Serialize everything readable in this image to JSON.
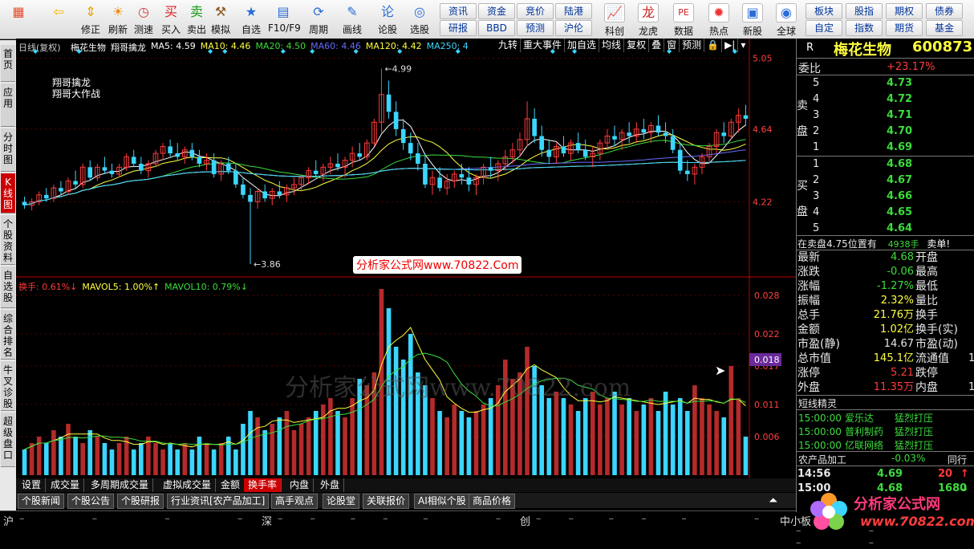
{
  "toolbar": {
    "buttons": [
      {
        "label": "",
        "icon": "grid-icon"
      },
      {
        "label": "",
        "icon": "back-icon"
      },
      {
        "label": "修正",
        "icon": "adjust-icon"
      },
      {
        "label": "刷新",
        "icon": "refresh-icon"
      },
      {
        "label": "测速",
        "icon": "clock-icon"
      },
      {
        "label": "买入",
        "icon": "buy-icon",
        "glyph": "买"
      },
      {
        "label": "卖出",
        "icon": "sell-icon",
        "glyph": "卖"
      },
      {
        "label": "模拟",
        "icon": "gavel-icon"
      },
      {
        "label": "自选",
        "icon": "star-icon"
      },
      {
        "label": "F10/F9",
        "icon": "doc-icon"
      },
      {
        "label": "周期",
        "icon": "cycle-icon"
      },
      {
        "label": "画线",
        "icon": "pencil-icon"
      },
      {
        "label": "论股",
        "icon": "chat-icon"
      },
      {
        "label": "选股",
        "icon": "select-icon"
      }
    ],
    "small_buttons": [
      "资讯",
      "资金",
      "竞价",
      "陆港",
      "研报",
      "BBD",
      "预测",
      "沪伦"
    ],
    "buttons2": [
      {
        "label": "科创",
        "icon": "chart-icon"
      },
      {
        "label": "龙虎",
        "icon": "dragon-icon"
      },
      {
        "label": "数据",
        "icon": "pe-icon",
        "glyph": "PE"
      },
      {
        "label": "热点",
        "icon": "fire-icon"
      },
      {
        "label": "新股",
        "icon": "newstock-icon"
      },
      {
        "label": "全球",
        "icon": "globe-icon"
      }
    ],
    "small_buttons2": [
      "板块",
      "股指",
      "期权",
      "债券",
      "自定",
      "指数",
      "期货",
      "基金"
    ]
  },
  "sidetabs": [
    {
      "label": "首页",
      "active": false
    },
    {
      "label": "应用",
      "active": false
    },
    {
      "label": "分时图",
      "active": false
    },
    {
      "label": "K线图",
      "active": true
    },
    {
      "label": "个股资料",
      "active": false
    },
    {
      "label": "自选股",
      "active": false
    },
    {
      "label": "综合排名",
      "active": false
    },
    {
      "label": "牛叉诊股",
      "active": false
    },
    {
      "label": "超级盘口",
      "active": false
    }
  ],
  "chart": {
    "period": "日线(复权)",
    "stock_name": "梅花生物",
    "formula": "翔哥擒龙",
    "ma": [
      {
        "label": "MA5: 4.59",
        "color": "#ffffff"
      },
      {
        "label": "MA10: 4.46",
        "color": "#ffff40"
      },
      {
        "label": "MA20: 4.50",
        "color": "#3cdc3c"
      },
      {
        "label": "MA60: 4.46",
        "color": "#6a6aff"
      },
      {
        "label": "MA120: 4.42",
        "color": "#ffff40"
      },
      {
        "label": "MA250: 4",
        "color": "#3bd6ff"
      }
    ],
    "tools": [
      "九转",
      "重大事件",
      "加自选",
      "均线",
      "复权",
      "叠",
      "窗",
      "预测"
    ],
    "legend_lines": [
      "翔哥擒龙",
      "翔哥大作战"
    ],
    "watermark_label": "分析家公式网www.70822.Com",
    "watermark_big": "分析家公式网www.70822.com",
    "vol_header": [
      {
        "label": "换手: 0.61%",
        "color": "#ff3b3b",
        "arrow": "↓"
      },
      {
        "label": "MAVOL5: 1.00%",
        "color": "#ffff40",
        "arrow": "↑"
      },
      {
        "label": "MAVOL10: 0.79%",
        "color": "#3cdc3c",
        "arrow": "↓"
      }
    ]
  },
  "chart_data": [
    {
      "type": "candlestick",
      "title": "梅花生物 日线(复权)",
      "y_ticks": [
        5.05,
        4.64,
        4.22
      ],
      "ylim": [
        3.8,
        5.08
      ],
      "annotations": [
        {
          "text": "4.99",
          "value": 4.99
        },
        {
          "text": "3.86",
          "value": 3.86
        }
      ],
      "ohlc": [
        [
          4.22,
          4.25,
          4.18,
          4.2
        ],
        [
          4.2,
          4.24,
          4.17,
          4.22
        ],
        [
          4.22,
          4.28,
          4.2,
          4.26
        ],
        [
          4.26,
          4.3,
          4.22,
          4.24
        ],
        [
          4.24,
          4.32,
          4.22,
          4.3
        ],
        [
          4.3,
          4.34,
          4.26,
          4.28
        ],
        [
          4.28,
          4.36,
          4.26,
          4.34
        ],
        [
          4.34,
          4.4,
          4.3,
          4.32
        ],
        [
          4.32,
          4.44,
          4.3,
          4.42
        ],
        [
          4.42,
          4.46,
          4.34,
          4.36
        ],
        [
          4.36,
          4.44,
          4.34,
          4.42
        ],
        [
          4.42,
          4.48,
          4.38,
          4.4
        ],
        [
          4.4,
          4.44,
          4.36,
          4.38
        ],
        [
          4.38,
          4.44,
          4.36,
          4.42
        ],
        [
          4.42,
          4.5,
          4.4,
          4.48
        ],
        [
          4.48,
          4.52,
          4.42,
          4.44
        ],
        [
          4.44,
          4.48,
          4.38,
          4.4
        ],
        [
          4.4,
          4.46,
          4.36,
          4.44
        ],
        [
          4.44,
          4.52,
          4.42,
          4.5
        ],
        [
          4.5,
          4.56,
          4.46,
          4.54
        ],
        [
          4.54,
          4.58,
          4.48,
          4.5
        ],
        [
          4.5,
          4.56,
          4.46,
          4.48
        ],
        [
          4.48,
          4.54,
          4.44,
          4.52
        ],
        [
          4.52,
          4.56,
          4.46,
          4.48
        ],
        [
          4.48,
          4.52,
          4.42,
          4.44
        ],
        [
          4.44,
          4.5,
          4.4,
          4.46
        ],
        [
          4.46,
          4.5,
          4.36,
          4.38
        ],
        [
          4.38,
          4.46,
          4.34,
          4.44
        ],
        [
          4.44,
          4.48,
          4.38,
          4.4
        ],
        [
          4.4,
          4.44,
          4.3,
          4.32
        ],
        [
          4.32,
          4.36,
          4.24,
          4.26
        ],
        [
          4.26,
          4.3,
          3.86,
          4.22
        ],
        [
          4.22,
          4.3,
          4.18,
          4.28
        ],
        [
          4.28,
          4.32,
          4.22,
          4.24
        ],
        [
          4.24,
          4.3,
          4.2,
          4.28
        ],
        [
          4.28,
          4.34,
          4.24,
          4.26
        ],
        [
          4.26,
          4.32,
          4.22,
          4.3
        ],
        [
          4.3,
          4.36,
          4.26,
          4.32
        ],
        [
          4.32,
          4.38,
          4.28,
          4.36
        ],
        [
          4.36,
          4.42,
          4.32,
          4.4
        ],
        [
          4.4,
          4.46,
          4.36,
          4.38
        ],
        [
          4.38,
          4.44,
          4.34,
          4.42
        ],
        [
          4.42,
          4.48,
          4.38,
          4.44
        ],
        [
          4.44,
          4.5,
          4.4,
          4.42
        ],
        [
          4.42,
          4.48,
          4.36,
          4.46
        ],
        [
          4.46,
          4.54,
          4.42,
          4.5
        ],
        [
          4.5,
          4.56,
          4.46,
          4.48
        ],
        [
          4.48,
          4.58,
          4.46,
          4.56
        ],
        [
          4.56,
          4.7,
          4.54,
          4.68
        ],
        [
          4.68,
          4.99,
          4.62,
          4.84
        ],
        [
          4.84,
          4.92,
          4.7,
          4.74
        ],
        [
          4.74,
          4.8,
          4.6,
          4.64
        ],
        [
          4.64,
          4.7,
          4.52,
          4.56
        ],
        [
          4.56,
          4.62,
          4.46,
          4.5
        ],
        [
          4.5,
          4.56,
          4.4,
          4.44
        ],
        [
          4.44,
          4.5,
          4.3,
          4.32
        ],
        [
          4.32,
          4.4,
          4.26,
          4.36
        ],
        [
          4.36,
          4.42,
          4.28,
          4.3
        ],
        [
          4.3,
          4.38,
          4.26,
          4.34
        ],
        [
          4.34,
          4.4,
          4.3,
          4.38
        ],
        [
          4.38,
          4.44,
          4.32,
          4.36
        ],
        [
          4.36,
          4.42,
          4.28,
          4.32
        ],
        [
          4.32,
          4.38,
          4.26,
          4.36
        ],
        [
          4.36,
          4.44,
          4.32,
          4.42
        ],
        [
          4.42,
          4.48,
          4.36,
          4.4
        ],
        [
          4.4,
          4.46,
          4.34,
          4.44
        ],
        [
          4.44,
          4.52,
          4.4,
          4.48
        ],
        [
          4.48,
          4.56,
          4.44,
          4.52
        ],
        [
          4.52,
          4.62,
          4.48,
          4.58
        ],
        [
          4.58,
          4.8,
          4.54,
          4.7
        ],
        [
          4.7,
          4.76,
          4.56,
          4.6
        ],
        [
          4.6,
          4.66,
          4.48,
          4.52
        ],
        [
          4.52,
          4.58,
          4.44,
          4.48
        ],
        [
          4.48,
          4.56,
          4.44,
          4.54
        ],
        [
          4.54,
          4.6,
          4.48,
          4.5
        ],
        [
          4.5,
          4.58,
          4.46,
          4.56
        ],
        [
          4.56,
          4.62,
          4.5,
          4.52
        ],
        [
          4.52,
          4.58,
          4.46,
          4.48
        ],
        [
          4.48,
          4.54,
          4.42,
          4.5
        ],
        [
          4.5,
          4.58,
          4.46,
          4.56
        ],
        [
          4.56,
          4.64,
          4.52,
          4.6
        ],
        [
          4.6,
          4.66,
          4.54,
          4.58
        ],
        [
          4.58,
          4.64,
          4.52,
          4.62
        ],
        [
          4.62,
          4.68,
          4.56,
          4.6
        ],
        [
          4.6,
          4.68,
          4.56,
          4.64
        ],
        [
          4.64,
          4.7,
          4.58,
          4.62
        ],
        [
          4.62,
          4.68,
          4.56,
          4.66
        ],
        [
          4.66,
          4.72,
          4.6,
          4.62
        ],
        [
          4.62,
          4.68,
          4.56,
          4.6
        ],
        [
          4.6,
          4.64,
          4.5,
          4.52
        ],
        [
          4.52,
          4.56,
          4.38,
          4.4
        ],
        [
          4.4,
          4.46,
          4.34,
          4.38
        ],
        [
          4.38,
          4.44,
          4.32,
          4.42
        ],
        [
          4.42,
          4.5,
          4.38,
          4.48
        ],
        [
          4.48,
          4.56,
          4.44,
          4.54
        ],
        [
          4.54,
          4.64,
          4.5,
          4.62
        ],
        [
          4.62,
          4.68,
          4.56,
          4.6
        ],
        [
          4.6,
          4.7,
          4.58,
          4.68
        ],
        [
          4.68,
          4.76,
          4.62,
          4.72
        ],
        [
          4.72,
          4.78,
          4.66,
          4.7
        ]
      ]
    },
    {
      "type": "bar",
      "title": "换手",
      "y_ticks": [
        0.028,
        0.022,
        0.017,
        0.011,
        0.006
      ],
      "ylim": [
        0,
        0.03
      ],
      "current_value": 0.018,
      "values": [
        0.004,
        0.005,
        0.006,
        0.005,
        0.007,
        0.006,
        0.008,
        0.006,
        0.005,
        0.007,
        0.006,
        0.005,
        0.004,
        0.005,
        0.006,
        0.004,
        0.005,
        0.006,
        0.005,
        0.004,
        0.005,
        0.004,
        0.005,
        0.004,
        0.006,
        0.005,
        0.004,
        0.005,
        0.006,
        0.004,
        0.008,
        0.01,
        0.009,
        0.007,
        0.008,
        0.009,
        0.01,
        0.007,
        0.008,
        0.009,
        0.01,
        0.011,
        0.012,
        0.01,
        0.009,
        0.012,
        0.015,
        0.014,
        0.016,
        0.029,
        0.026,
        0.02,
        0.018,
        0.022,
        0.016,
        0.014,
        0.012,
        0.01,
        0.009,
        0.011,
        0.01,
        0.009,
        0.01,
        0.011,
        0.012,
        0.014,
        0.018,
        0.015,
        0.016,
        0.02,
        0.017,
        0.014,
        0.012,
        0.013,
        0.012,
        0.011,
        0.01,
        0.012,
        0.013,
        0.011,
        0.012,
        0.013,
        0.011,
        0.012,
        0.01,
        0.011,
        0.012,
        0.01,
        0.013,
        0.011,
        0.012,
        0.01,
        0.014,
        0.012,
        0.011,
        0.01,
        0.009,
        0.017,
        0.012,
        0.006
      ]
    }
  ],
  "bottom_tabs": [
    "设置",
    "成交量",
    "多周期成交量",
    "虚拟成交量",
    "金额",
    "换手率",
    "内盘",
    "外盘"
  ],
  "bottom_tabs_active": 5,
  "info_tabs": [
    "个股新闻",
    "个股公告",
    "个股研报",
    "行业资讯[农产品加工]",
    "高手观点",
    "论股堂",
    "关联报价",
    "AI相似个股",
    "商品价格"
  ],
  "statusbar": {
    "items": [
      "沪",
      "深",
      "创",
      "中小板"
    ]
  },
  "quote": {
    "market_flag": "R",
    "name": "梅花生物",
    "code": "600873",
    "weibi_label": "委比",
    "weibi": "+23.17%",
    "sell_label": "卖盘",
    "buy_label": "买盘",
    "asks": [
      {
        "lvl": "5",
        "price": "4.73"
      },
      {
        "lvl": "4",
        "price": "4.72"
      },
      {
        "lvl": "3",
        "price": "4.71"
      },
      {
        "lvl": "2",
        "price": "4.70"
      },
      {
        "lvl": "1",
        "price": "4.69"
      }
    ],
    "bids": [
      {
        "lvl": "1",
        "price": "4.68"
      },
      {
        "lvl": "2",
        "price": "4.67"
      },
      {
        "lvl": "3",
        "price": "4.66"
      },
      {
        "lvl": "4",
        "price": "4.65"
      },
      {
        "lvl": "5",
        "price": "4.64"
      }
    ],
    "sell_pos_text": "在卖盘4.75位置有",
    "sell_pos_qty": "4938手",
    "sell_pos_tag": "卖单!",
    "stats_left": [
      {
        "k": "最新",
        "v": "4.68",
        "c": "grn"
      },
      {
        "k": "涨跌",
        "v": "-0.06",
        "c": "grn"
      },
      {
        "k": "涨幅",
        "v": "-1.27%",
        "c": "grn"
      },
      {
        "k": "振幅",
        "v": "2.32%",
        "c": "yel"
      },
      {
        "k": "总手",
        "v": "21.76万",
        "c": "yel"
      },
      {
        "k": "金额",
        "v": "1.02亿",
        "c": "yel"
      },
      {
        "k": "市盈(静)",
        "v": "14.67",
        "c": "wht"
      },
      {
        "k": "总市值",
        "v": "145.1亿",
        "c": "yel"
      },
      {
        "k": "涨停",
        "v": "5.21",
        "c": "red"
      },
      {
        "k": "外盘",
        "v": "11.35万",
        "c": "red"
      }
    ],
    "stats_right": [
      "开盘",
      "最高",
      "最低",
      "量比",
      "换手",
      "换手(实)",
      "市盈(动)",
      "流通值",
      "跌停",
      "内盘"
    ],
    "stats_right_vals": [
      "",
      "",
      "",
      "",
      "",
      "",
      "",
      "1",
      "",
      "1"
    ],
    "shortline_title": "短线精灵",
    "shortline": [
      {
        "time": "15:00:00",
        "name": "爱乐达",
        "signal": "猛烈打压"
      },
      {
        "time": "15:00:00",
        "name": "普利制药",
        "signal": "猛烈打压"
      },
      {
        "time": "15:00:00",
        "name": "亿联网络",
        "signal": "猛烈打压"
      }
    ],
    "industry": "农产品加工",
    "industry_chg": "-0.03%",
    "industry_more": "同行",
    "ticks": [
      {
        "time": "14:56",
        "price": "4.69",
        "vol": "20",
        "arrow": "↑"
      },
      {
        "time": "15:00",
        "price": "4.68",
        "vol": "1680",
        "arrow": "↓"
      }
    ]
  },
  "watermark_logo": {
    "name": "分析家公式网",
    "url": "www.70822.com"
  }
}
